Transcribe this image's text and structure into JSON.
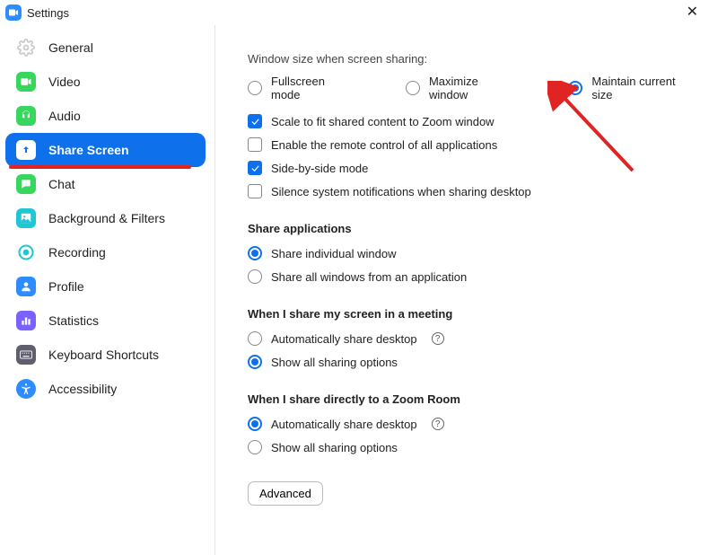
{
  "window": {
    "title": "Settings"
  },
  "sidebar": {
    "items": [
      {
        "label": "General"
      },
      {
        "label": "Video"
      },
      {
        "label": "Audio"
      },
      {
        "label": "Share Screen"
      },
      {
        "label": "Chat"
      },
      {
        "label": "Background & Filters"
      },
      {
        "label": "Recording"
      },
      {
        "label": "Profile"
      },
      {
        "label": "Statistics"
      },
      {
        "label": "Keyboard Shortcuts"
      },
      {
        "label": "Accessibility"
      }
    ]
  },
  "main": {
    "windowSize": {
      "heading": "Window size when screen sharing:",
      "options": {
        "fullscreen": "Fullscreen mode",
        "maximize": "Maximize window",
        "maintain": "Maintain current size"
      }
    },
    "checks": {
      "scale": "Scale to fit shared content to Zoom window",
      "remote": "Enable the remote control of all applications",
      "sbs": "Side-by-side mode",
      "silence": "Silence system notifications when sharing desktop"
    },
    "shareApps": {
      "heading": "Share applications",
      "individual": "Share individual window",
      "all": "Share all windows from an application"
    },
    "meeting": {
      "heading": "When I share my screen in a meeting",
      "auto": "Automatically share desktop",
      "showAll": "Show all sharing options"
    },
    "zoomRoom": {
      "heading": "When I share directly to a Zoom Room",
      "auto": "Automatically share desktop",
      "showAll": "Show all sharing options"
    },
    "advanced": "Advanced"
  }
}
